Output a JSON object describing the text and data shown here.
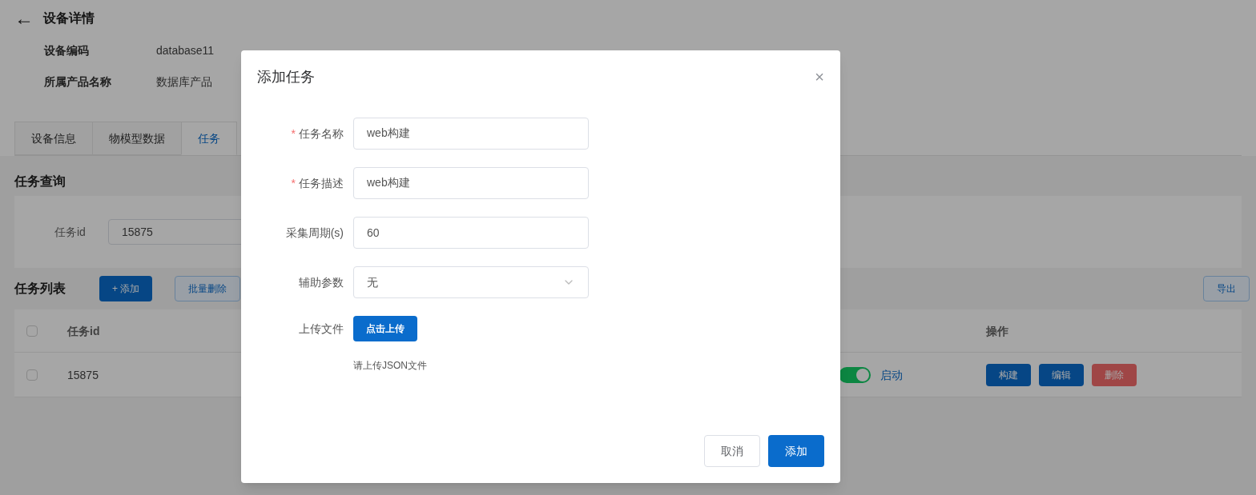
{
  "header": {
    "back": "←",
    "title": "设备详情"
  },
  "info": [
    {
      "label": "设备编码",
      "value": "database11"
    },
    {
      "label": "所属产品名称",
      "value": "数据库产品"
    }
  ],
  "tabs": [
    {
      "label": "设备信息",
      "selected": false
    },
    {
      "label": "物模型数据",
      "selected": false
    },
    {
      "label": "任务",
      "selected": true
    }
  ],
  "query": {
    "title": "任务查询",
    "label": "任务id",
    "value": "15875"
  },
  "list": {
    "title": "任务列表",
    "add": "+ 添加",
    "batch_delete": "批量删除",
    "export": "导出",
    "header_checked": false,
    "columns": [
      "任务id",
      "操作"
    ],
    "rows": [
      {
        "checked": false,
        "id": "15875",
        "on": true,
        "status": "启动",
        "actions": [
          {
            "label": "构建",
            "kind": "primary"
          },
          {
            "label": "编辑",
            "kind": "primary"
          },
          {
            "label": "删除",
            "kind": "danger"
          }
        ]
      }
    ]
  },
  "dialog": {
    "title": "添加任务",
    "close": "×",
    "fields": [
      {
        "kind": "input",
        "label": "任务名称",
        "required_mark": "*",
        "value": "web构建"
      },
      {
        "kind": "input",
        "label": "任务描述",
        "required_mark": "*",
        "value": "web构建"
      },
      {
        "kind": "input",
        "label": "采集周期(s)",
        "value": "60"
      },
      {
        "kind": "select",
        "label": "辅助参数",
        "value": "无"
      },
      {
        "kind": "upload",
        "label": "上传文件",
        "button": "点击上传",
        "hint": "请上传JSON文件"
      }
    ],
    "buttons": [
      {
        "label": "取消",
        "kind": "default"
      },
      {
        "label": "添加",
        "kind": "primary"
      }
    ]
  }
}
